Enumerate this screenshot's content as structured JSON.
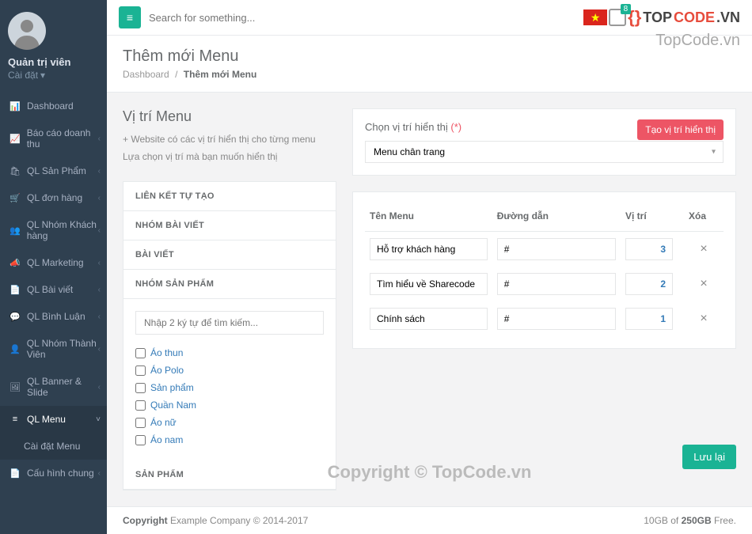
{
  "sidebar": {
    "admin_name": "Quản trị viên",
    "sub": "Cài đặt",
    "items": [
      {
        "icon": "📊",
        "label": "Dashboard",
        "has_sub": false
      },
      {
        "icon": "📈",
        "label": "Báo cáo doanh thu",
        "has_sub": true
      },
      {
        "icon": "🛍",
        "label": "QL Sản Phẩm",
        "has_sub": true
      },
      {
        "icon": "🛒",
        "label": "QL đơn hàng",
        "has_sub": true
      },
      {
        "icon": "👥",
        "label": "QL Nhóm Khách hàng",
        "has_sub": true
      },
      {
        "icon": "📣",
        "label": "QL Marketing",
        "has_sub": true
      },
      {
        "icon": "📄",
        "label": "QL Bài viết",
        "has_sub": true
      },
      {
        "icon": "💬",
        "label": "QL Bình Luận",
        "has_sub": true
      },
      {
        "icon": "👤",
        "label": "QL Nhóm Thành Viên",
        "has_sub": true
      },
      {
        "icon": "🖼",
        "label": "QL Banner & Slide",
        "has_sub": true
      },
      {
        "icon": "≡",
        "label": "QL Menu",
        "has_sub": true,
        "active": true
      },
      {
        "icon": "📄",
        "label": "Cấu hình chung",
        "has_sub": true
      }
    ],
    "active_sub": "Cài đặt Menu"
  },
  "topbar": {
    "search_placeholder": "Search for something...",
    "badge": "8",
    "logo_top": "TOP",
    "logo_code": "CODE",
    "logo_vn": ".VN",
    "watermark": "TopCode.vn"
  },
  "page": {
    "title": "Thêm mới Menu",
    "bc1": "Dashboard",
    "bc2": "Thêm mới Menu"
  },
  "left": {
    "title": "Vị trí Menu",
    "desc1": "+ Website có các vị trí hiển thị cho từng menu",
    "desc2": "Lựa chọn vị trí mà bạn muốn hiển thị",
    "tabs": [
      "LIÊN KẾT TỰ TẠO",
      "NHÓM BÀI VIẾT",
      "BÀI VIẾT",
      "NHÓM SẢN PHẨM"
    ],
    "search_ph": "Nhập 2 ký tự để tìm kiếm...",
    "products": [
      "Áo thun",
      "Áo Polo",
      "Sản phẩm",
      "Quần Nam",
      "Áo nữ",
      "Áo nam"
    ],
    "footer_tab": "SẢN PHẨM"
  },
  "right": {
    "pos_label": "Chọn vị trí hiển thị",
    "req": "(*)",
    "btn_create": "Tạo vị trí hiển thị",
    "selected": "Menu chân trang",
    "cols": [
      "Tên Menu",
      "Đường dẫn",
      "Vị trí",
      "Xóa"
    ],
    "rows": [
      {
        "name": "Hỗ trợ khách hàng",
        "url": "#",
        "pos": "3"
      },
      {
        "name": "Tìm hiểu về Sharecode",
        "url": "#",
        "pos": "2"
      },
      {
        "name": "Chính sách",
        "url": "#",
        "pos": "1"
      }
    ]
  },
  "watermark_center": "Copyright © TopCode.vn",
  "save": "Lưu lại",
  "footer": {
    "left1": "Copyright",
    "left2": "Example Company",
    "left3": "© 2014-2017",
    "right1": "10GB of",
    "right2": "250GB",
    "right3": "Free."
  }
}
